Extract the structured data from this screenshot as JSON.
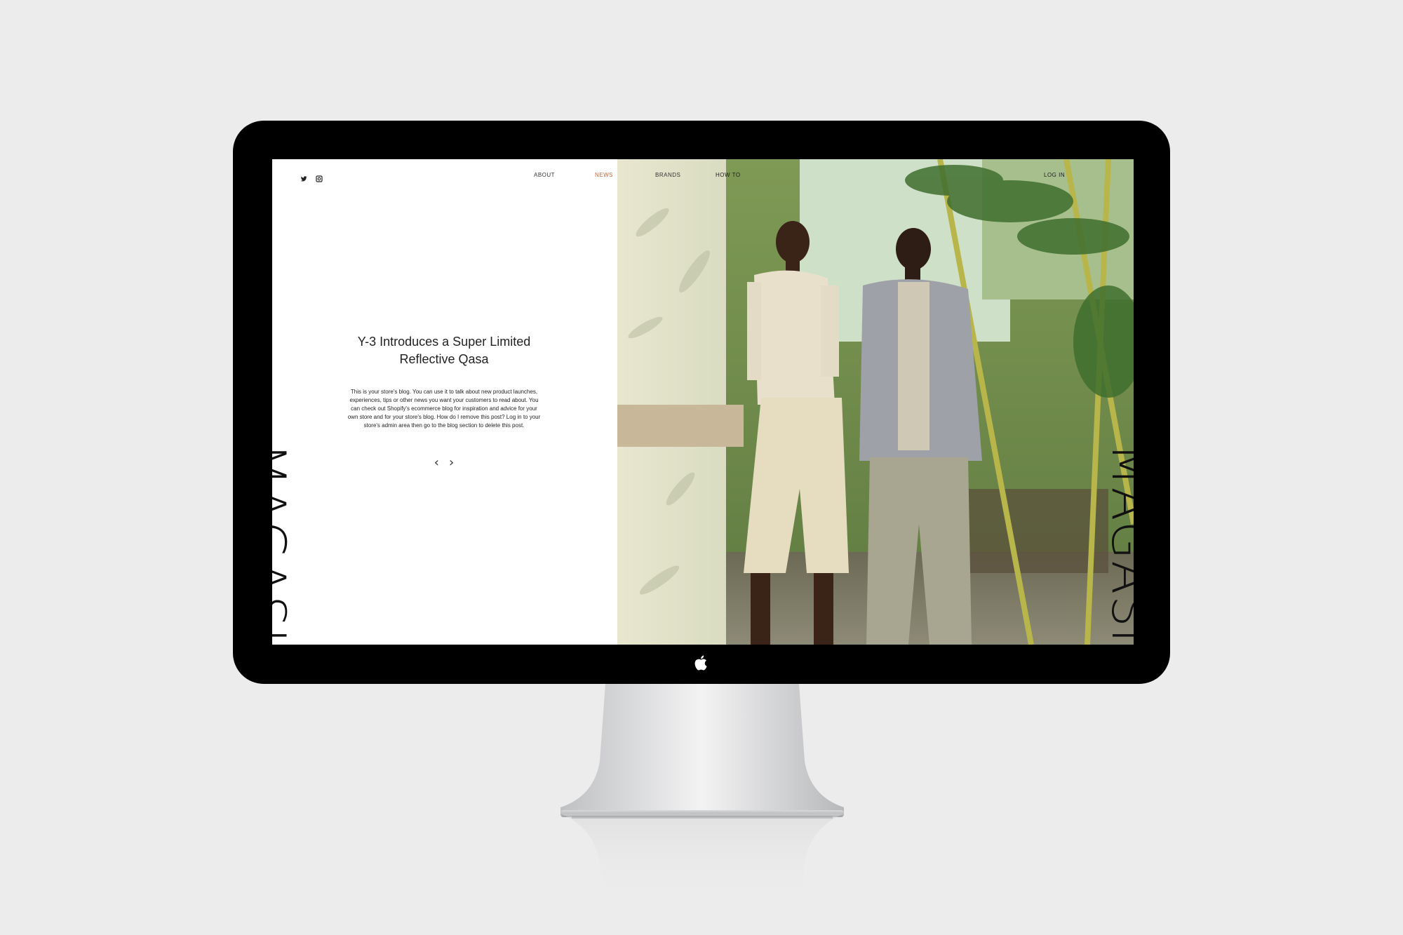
{
  "site": {
    "nav": [
      {
        "label": "ABOUT",
        "active": false
      },
      {
        "label": "NEWS",
        "active": true
      },
      {
        "label": "BRANDS",
        "active": false
      },
      {
        "label": "HOW TO",
        "active": false
      },
      {
        "label": "LOG IN",
        "active": false
      }
    ],
    "logo_vertical": "MAGASIN",
    "post": {
      "title": "Y-3 Introduces a Super Limited Reflective Qasa",
      "body": "This is your store's blog. You can use it to talk about new product launches, experiences, tips or other news you want your customers to read about. You can check out Shopify's ecommerce blog for inspiration and advice for your own store and for your store's blog. How do I remove this post? Log in to your store's admin area then go to the blog section to delete this post."
    },
    "pager": {
      "prev": "‹",
      "next": "›"
    },
    "icons": [
      "twitter-icon",
      "instagram-icon"
    ]
  },
  "colors": {
    "accent": "#c9643a",
    "bezel": "#000000",
    "background": "#ececec"
  }
}
